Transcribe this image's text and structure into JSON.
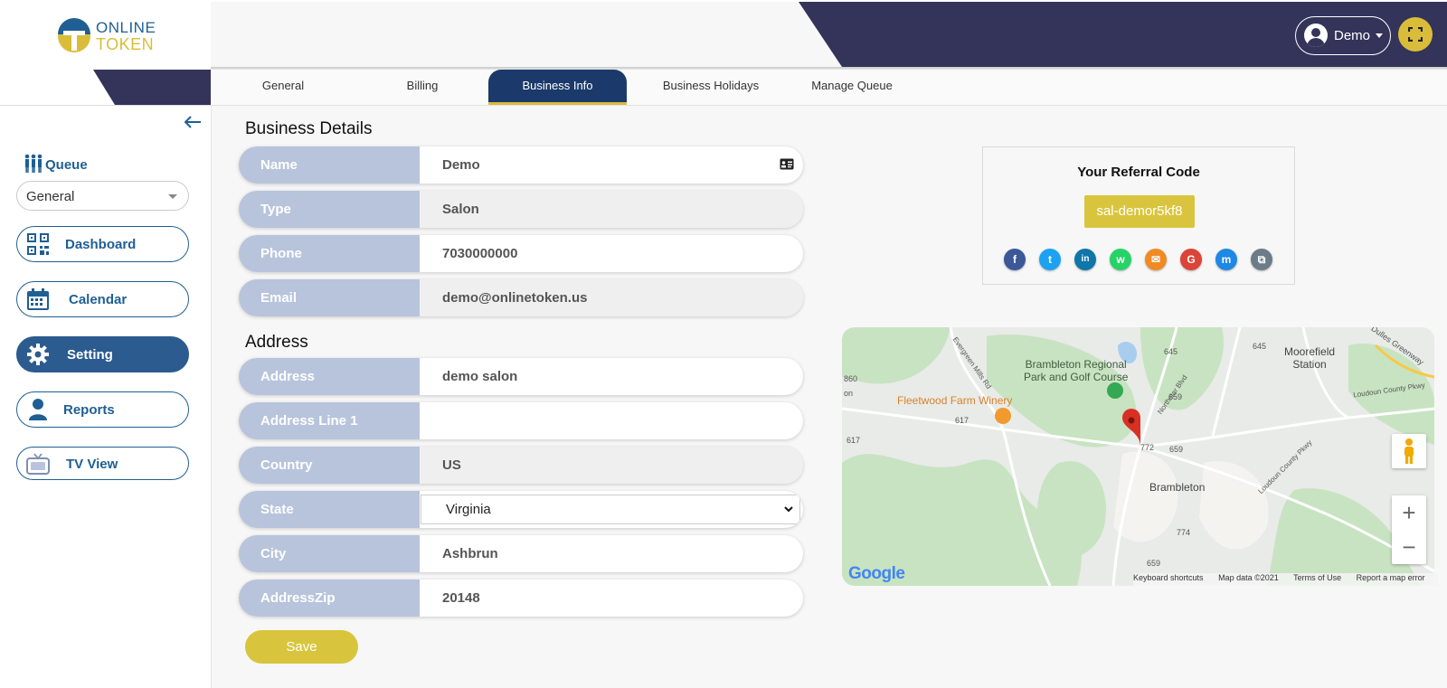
{
  "brand": {
    "line1": "ONLINE",
    "line2": "TOKEN",
    "blue": "#1f5f93",
    "yellow": "#d9bd3a",
    "navy": "#34345a"
  },
  "header": {
    "user_name": "Demo",
    "user_icon": "user-circle-icon",
    "fullscreen_icon": "fullscreen-icon"
  },
  "sidebar": {
    "queue_label": "Queue",
    "queue_value": "General",
    "items": [
      {
        "label": "Dashboard",
        "icon": "qr-code-icon",
        "active": false
      },
      {
        "label": "Calendar",
        "icon": "calendar-icon",
        "active": false
      },
      {
        "label": "Setting",
        "icon": "gear-icon",
        "active": true
      },
      {
        "label": "Reports",
        "icon": "user-icon",
        "active": false
      },
      {
        "label": "TV View",
        "icon": "tv-icon",
        "active": false
      }
    ]
  },
  "tabs": [
    {
      "label": "General",
      "active": false
    },
    {
      "label": "Billing",
      "active": false
    },
    {
      "label": "Business Info",
      "active": true
    },
    {
      "label": "Business Holidays",
      "active": false
    },
    {
      "label": "Manage Queue",
      "active": false
    }
  ],
  "business_details": {
    "title": "Business Details",
    "fields": [
      {
        "label": "Name",
        "value": "Demo"
      },
      {
        "label": "Type",
        "value": "Salon"
      },
      {
        "label": "Phone",
        "value": "7030000000"
      },
      {
        "label": "Email",
        "value": "demo@onlinetoken.us"
      }
    ]
  },
  "address": {
    "title": "Address",
    "fields": [
      {
        "label": "Address",
        "value": "demo salon"
      },
      {
        "label": "Address Line 1",
        "value": ""
      },
      {
        "label": "Country",
        "value": "US"
      },
      {
        "label": "State",
        "value": "Virginia"
      },
      {
        "label": "City",
        "value": "Ashbrun"
      },
      {
        "label": "AddressZip",
        "value": "20148"
      }
    ]
  },
  "save_label": "Save",
  "referral": {
    "title": "Your Referral Code",
    "code": "sal-demor5kf8",
    "share": [
      {
        "icon": "facebook-icon",
        "glyph": "f",
        "color": "#3b5998"
      },
      {
        "icon": "twitter-icon",
        "glyph": "t",
        "color": "#1da1f2"
      },
      {
        "icon": "linkedin-icon",
        "glyph": "in",
        "color": "#0e76a8"
      },
      {
        "icon": "whatsapp-icon",
        "glyph": "w",
        "color": "#25d366"
      },
      {
        "icon": "email-icon",
        "glyph": "✉",
        "color": "#f08a24"
      },
      {
        "icon": "google-icon",
        "glyph": "G",
        "color": "#db4437"
      },
      {
        "icon": "messenger-icon",
        "glyph": "m",
        "color": "#1e88e5"
      },
      {
        "icon": "copy-icon",
        "glyph": "⧉",
        "color": "#6b7b88"
      }
    ]
  },
  "map": {
    "labels": {
      "park": "Brambleton Regional\nPark and Golf Course",
      "winery": "Fleetwood Farm Winery",
      "town": "Brambleton",
      "station": "Moorefield\nStation",
      "road1": "Evergreen Mills Rd",
      "road2": "Northstar Blvd",
      "road3": "Loudoun County Pkwy",
      "road4": "Loudoun County Pkwy",
      "road5": "Dulles Greenway",
      "r645a": "645",
      "r645b": "645",
      "r659a": "659",
      "r659b": "659",
      "r659c": "659",
      "r617a": "617",
      "r617b": "617",
      "r772": "772",
      "r774": "774",
      "r860": "860",
      "on": "on"
    },
    "google": "Google",
    "footer": {
      "shortcuts": "Keyboard shortcuts",
      "data": "Map data ©2021",
      "terms": "Terms of Use",
      "report": "Report a map error"
    },
    "zoom_in": "+",
    "zoom_out": "−"
  }
}
